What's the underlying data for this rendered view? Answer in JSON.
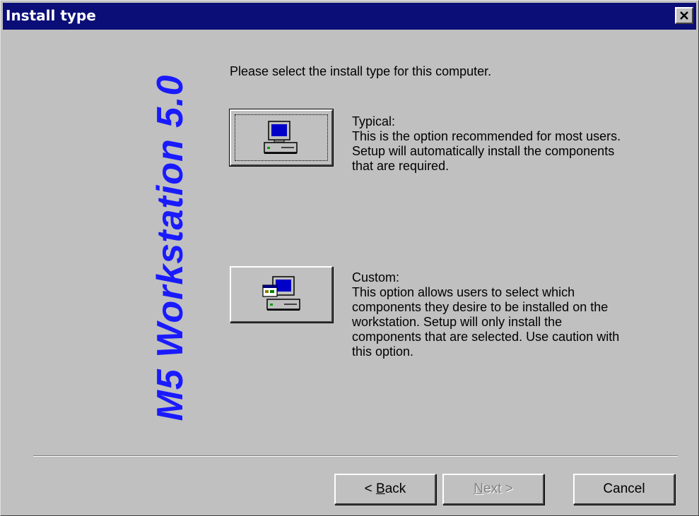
{
  "window": {
    "title": "Install type",
    "close_glyph": "✕"
  },
  "branding": {
    "product": "M5 Workstation 5.0",
    "color": "#1a1aff"
  },
  "instruction": "Please select the install type for this computer.",
  "options": [
    {
      "icon": "computer-icon",
      "heading": "Typical:",
      "lines": [
        "This is the option recommended for most users.",
        "Setup will automatically install the components",
        "that are required."
      ]
    },
    {
      "icon": "custom-install-icon",
      "heading": "Custom:",
      "lines": [
        "This option allows users to select which",
        "components they desire to be installed on the",
        "workstation.  Setup will only install the",
        "components that are selected. Use caution with",
        "this option."
      ]
    }
  ],
  "buttons": {
    "back_prefix": "< ",
    "back_mnemonic": "B",
    "back_rest": "ack",
    "next_mnemonic": "N",
    "next_rest": "ext >",
    "next_enabled": false,
    "cancel": "Cancel"
  },
  "colors": {
    "titlebar": "#0a0e76",
    "face": "#c0c0c0"
  }
}
